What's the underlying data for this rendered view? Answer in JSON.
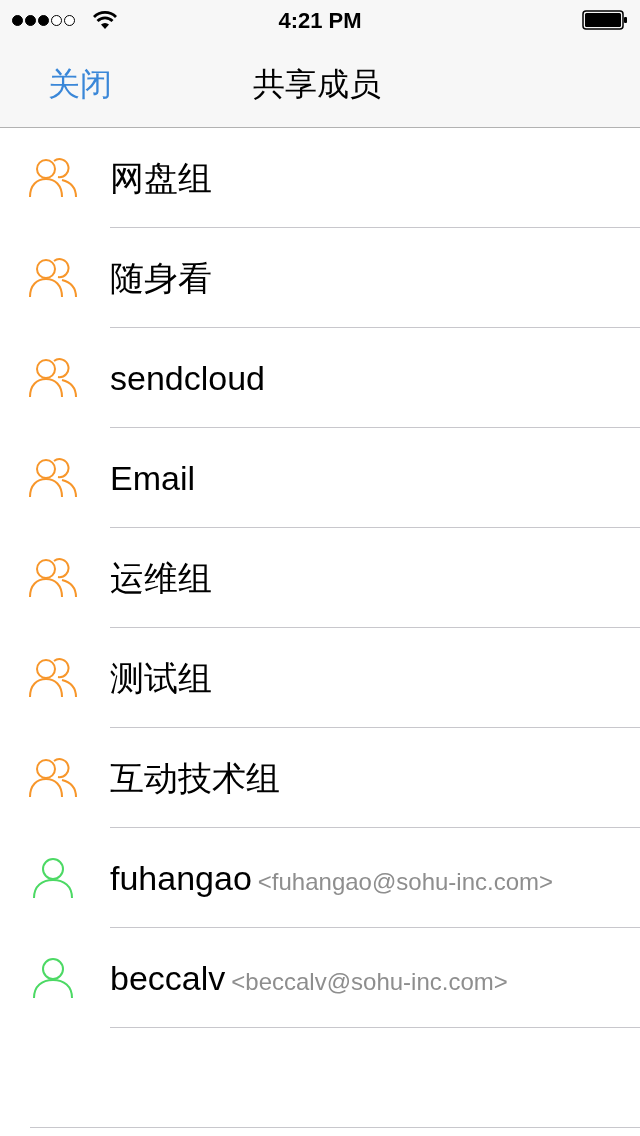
{
  "status_bar": {
    "signal_dots": [
      {
        "filled": true
      },
      {
        "filled": true
      },
      {
        "filled": true
      },
      {
        "filled": false
      },
      {
        "filled": false
      }
    ],
    "time": "4:21 PM"
  },
  "nav": {
    "close": "关闭",
    "title": "共享成员"
  },
  "members": [
    {
      "kind": "group",
      "name": "网盘组"
    },
    {
      "kind": "group",
      "name": "随身看"
    },
    {
      "kind": "group",
      "name": "sendcloud"
    },
    {
      "kind": "group",
      "name": "Email"
    },
    {
      "kind": "group",
      "name": "运维组"
    },
    {
      "kind": "group",
      "name": "测试组"
    },
    {
      "kind": "group",
      "name": "互动技术组"
    },
    {
      "kind": "person",
      "name": "fuhangao",
      "email": "<fuhangao@sohu-inc.com>"
    },
    {
      "kind": "person",
      "name": "beccalv",
      "email": "<beccalv@sohu-inc.com>"
    }
  ]
}
